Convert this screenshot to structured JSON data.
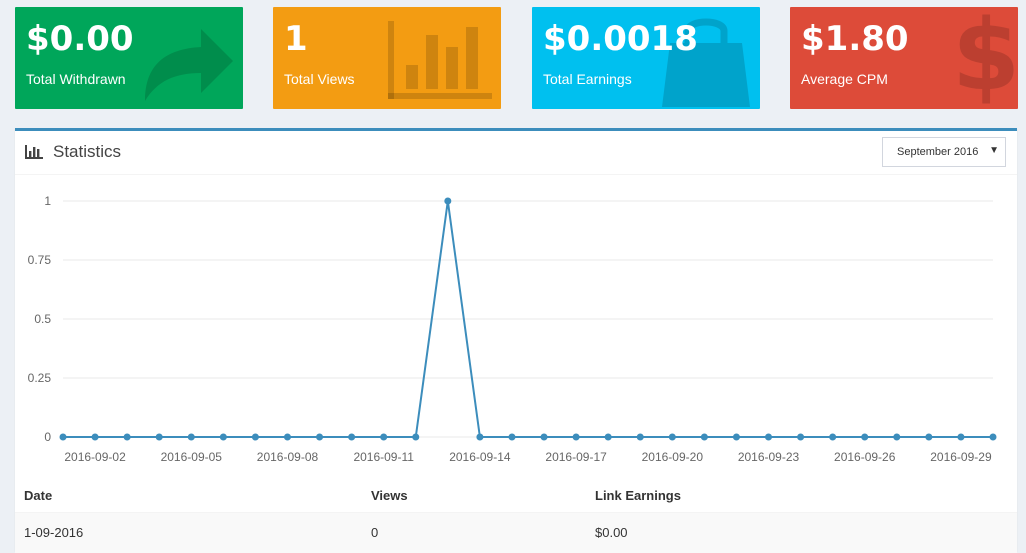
{
  "cards": [
    {
      "value": "$0.00",
      "label": "Total Withdrawn",
      "color": "#00a65a",
      "icon": "share-arrow-icon"
    },
    {
      "value": "1",
      "label": "Total Views",
      "color": "#f39c12",
      "icon": "bar-chart-icon"
    },
    {
      "value": "$0.0018",
      "label": "Total Earnings",
      "color": "#00c0ef",
      "icon": "shopping-bag-icon"
    },
    {
      "value": "$1.80",
      "label": "Average CPM",
      "color": "#dd4b39",
      "icon": "dollar-icon"
    }
  ],
  "statistics": {
    "title": "Statistics",
    "month_select": "September 2016"
  },
  "chart_data": {
    "type": "line",
    "x": [
      "2016-09-01",
      "2016-09-02",
      "2016-09-03",
      "2016-09-04",
      "2016-09-05",
      "2016-09-06",
      "2016-09-07",
      "2016-09-08",
      "2016-09-09",
      "2016-09-10",
      "2016-09-11",
      "2016-09-12",
      "2016-09-13",
      "2016-09-14",
      "2016-09-15",
      "2016-09-16",
      "2016-09-17",
      "2016-09-18",
      "2016-09-19",
      "2016-09-20",
      "2016-09-21",
      "2016-09-22",
      "2016-09-23",
      "2016-09-24",
      "2016-09-25",
      "2016-09-26",
      "2016-09-27",
      "2016-09-28",
      "2016-09-29",
      "2016-09-30"
    ],
    "series": [
      {
        "values": [
          0,
          0,
          0,
          0,
          0,
          0,
          0,
          0,
          0,
          0,
          0,
          0,
          1,
          0,
          0,
          0,
          0,
          0,
          0,
          0,
          0,
          0,
          0,
          0,
          0,
          0,
          0,
          0,
          0,
          0
        ]
      }
    ],
    "x_tick_labels": [
      "2016-09-02",
      "2016-09-05",
      "2016-09-08",
      "2016-09-11",
      "2016-09-14",
      "2016-09-17",
      "2016-09-20",
      "2016-09-23",
      "2016-09-26",
      "2016-09-29"
    ],
    "y_ticks": [
      "0",
      "0.25",
      "0.5",
      "0.75",
      "1"
    ],
    "ylim": [
      0,
      1
    ],
    "grid": true,
    "line_color": "#3c8dbc",
    "grid_color": "#e8e8e8"
  },
  "table": {
    "headers": [
      "Date",
      "Views",
      "Link Earnings"
    ],
    "rows": [
      [
        "1-09-2016",
        "0",
        "$0.00"
      ]
    ]
  }
}
